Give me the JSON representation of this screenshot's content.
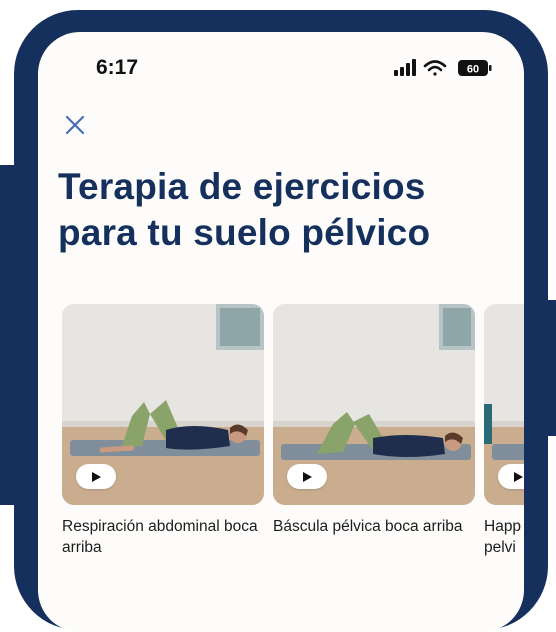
{
  "status_bar": {
    "time": "6:17",
    "battery": "60",
    "icons": [
      "cellular-signal-icon",
      "wifi-icon",
      "battery-icon"
    ]
  },
  "header": {
    "close_icon": "close-icon"
  },
  "page": {
    "title_line1": "Terapia de ejercicios",
    "title_line2": "para tu suelo pélvico"
  },
  "exercises": [
    {
      "label": "Respiración abdominal boca arriba",
      "play_icon": "play-icon"
    },
    {
      "label": "Báscula pélvica boca arriba",
      "play_icon": "play-icon"
    },
    {
      "label": "Happ pelvi",
      "play_icon": "play-icon"
    }
  ],
  "colors": {
    "brand_navy": "#15305c",
    "screen_background": "#fdfcfa",
    "text": "#1d1d1d",
    "close_icon": "#4a6fb5"
  }
}
